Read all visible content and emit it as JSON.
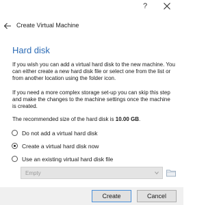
{
  "titlebar": {
    "help_label": "?"
  },
  "wizard": {
    "title": "Create Virtual Machine"
  },
  "page": {
    "title": "Hard disk",
    "paragraph1": "If you wish you can add a virtual hard disk to the new machine. You can either create a new hard disk file or select one from the list or from another location using the folder icon.",
    "paragraph2": "If you need a more complex storage set-up you can skip this step and make the changes to the machine settings once the machine is created.",
    "recommended_prefix": "The recommended size of the hard disk is ",
    "recommended_size": "10.00 GB",
    "recommended_suffix": "."
  },
  "options": {
    "items": [
      {
        "label": "Do not add a virtual hard disk",
        "selected": false
      },
      {
        "label": "Create a virtual hard disk now",
        "selected": true
      },
      {
        "label": "Use an existing virtual hard disk file",
        "selected": false
      }
    ]
  },
  "existing_file": {
    "value": "Empty"
  },
  "buttons": {
    "create": "Create",
    "cancel": "Cancel"
  },
  "icons": {
    "close": "close-icon",
    "back": "back-arrow-icon",
    "dropdown": "chevron-down-icon",
    "folder": "folder-icon"
  },
  "colors": {
    "title_accent": "#2c6bb5",
    "footer_bg": "#f0f0f0",
    "disabled_combo_bg": "#e4e4e4"
  }
}
